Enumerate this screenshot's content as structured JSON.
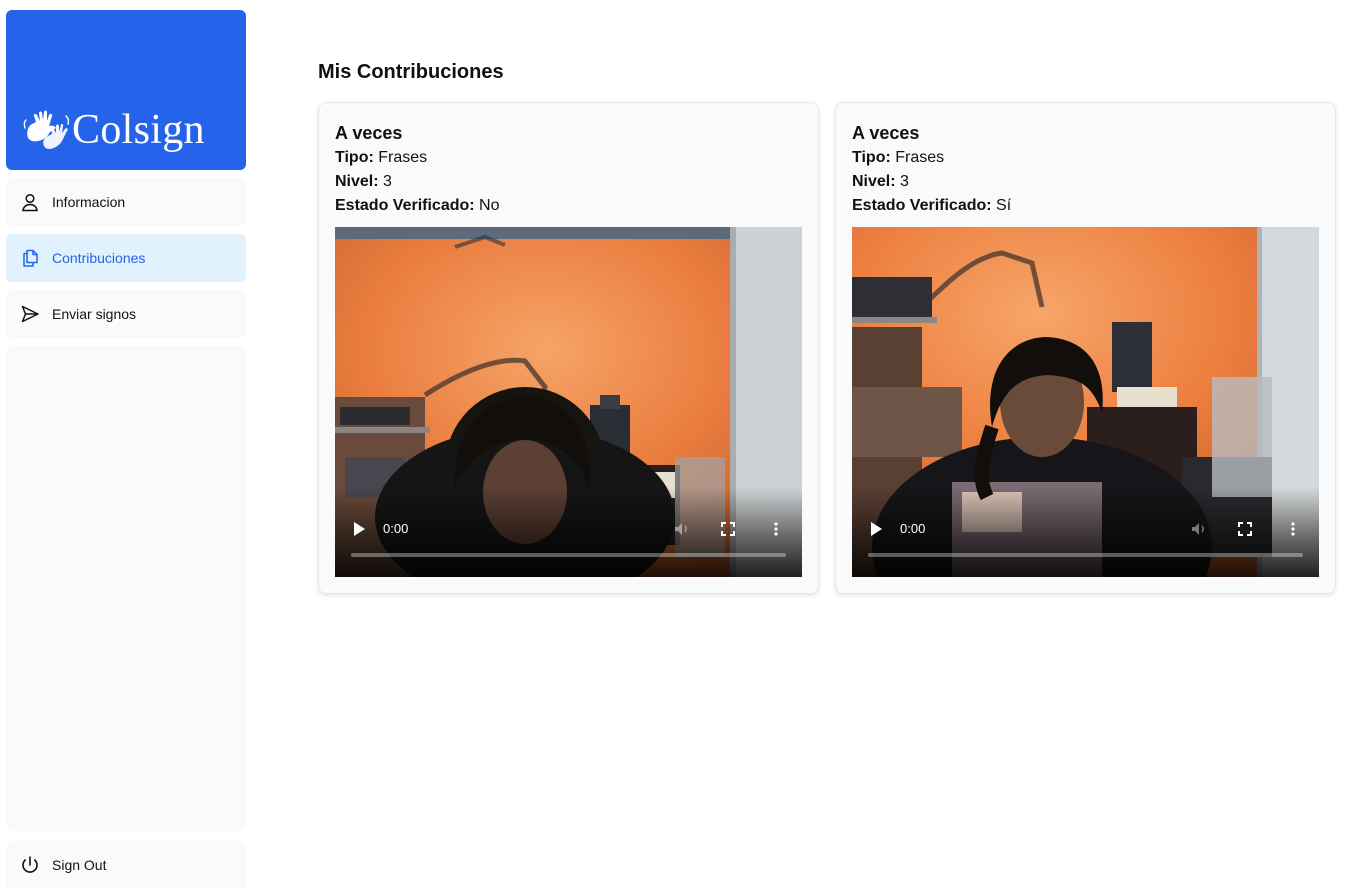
{
  "app": {
    "logo_text": "Colsign",
    "brand_color": "#2563eb"
  },
  "sidebar": {
    "items": [
      {
        "label": "Informacion",
        "icon": "user-icon",
        "active": false
      },
      {
        "label": "Contribuciones",
        "icon": "documents-icon",
        "active": true
      },
      {
        "label": "Enviar signos",
        "icon": "send-icon",
        "active": false
      }
    ],
    "sign_out": {
      "label": "Sign Out",
      "icon": "power-icon"
    }
  },
  "main": {
    "title": "Mis Contribuciones",
    "cards": [
      {
        "title": "A veces",
        "tipo_label": "Tipo:",
        "tipo": "Frases",
        "nivel_label": "Nivel:",
        "nivel": "3",
        "estado_label": "Estado Verificado:",
        "estado": "No",
        "video": {
          "time": "0:00",
          "progress": 0
        }
      },
      {
        "title": "A veces",
        "tipo_label": "Tipo:",
        "tipo": "Frases",
        "nivel_label": "Nivel:",
        "nivel": "3",
        "estado_label": "Estado Verificado:",
        "estado": "Sí",
        "video": {
          "time": "0:00",
          "progress": 0
        }
      }
    ]
  }
}
